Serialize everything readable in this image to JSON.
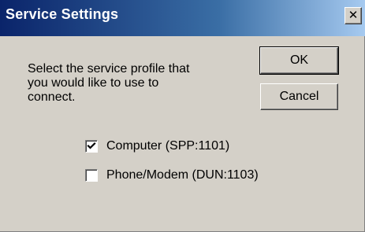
{
  "window": {
    "title": "Service Settings",
    "close_glyph": "✕"
  },
  "prompt": {
    "line1": "Select the service profile that",
    "line2": "you would like to use to",
    "line3": "connect."
  },
  "buttons": {
    "ok_label": "OK",
    "cancel_label": "Cancel"
  },
  "options": [
    {
      "label": "Computer (SPP:1101)",
      "checked": true
    },
    {
      "label": "Phone/Modem (DUN:1103)",
      "checked": false
    }
  ],
  "icons": {
    "close": "close-icon",
    "check": "checkmark-icon"
  }
}
